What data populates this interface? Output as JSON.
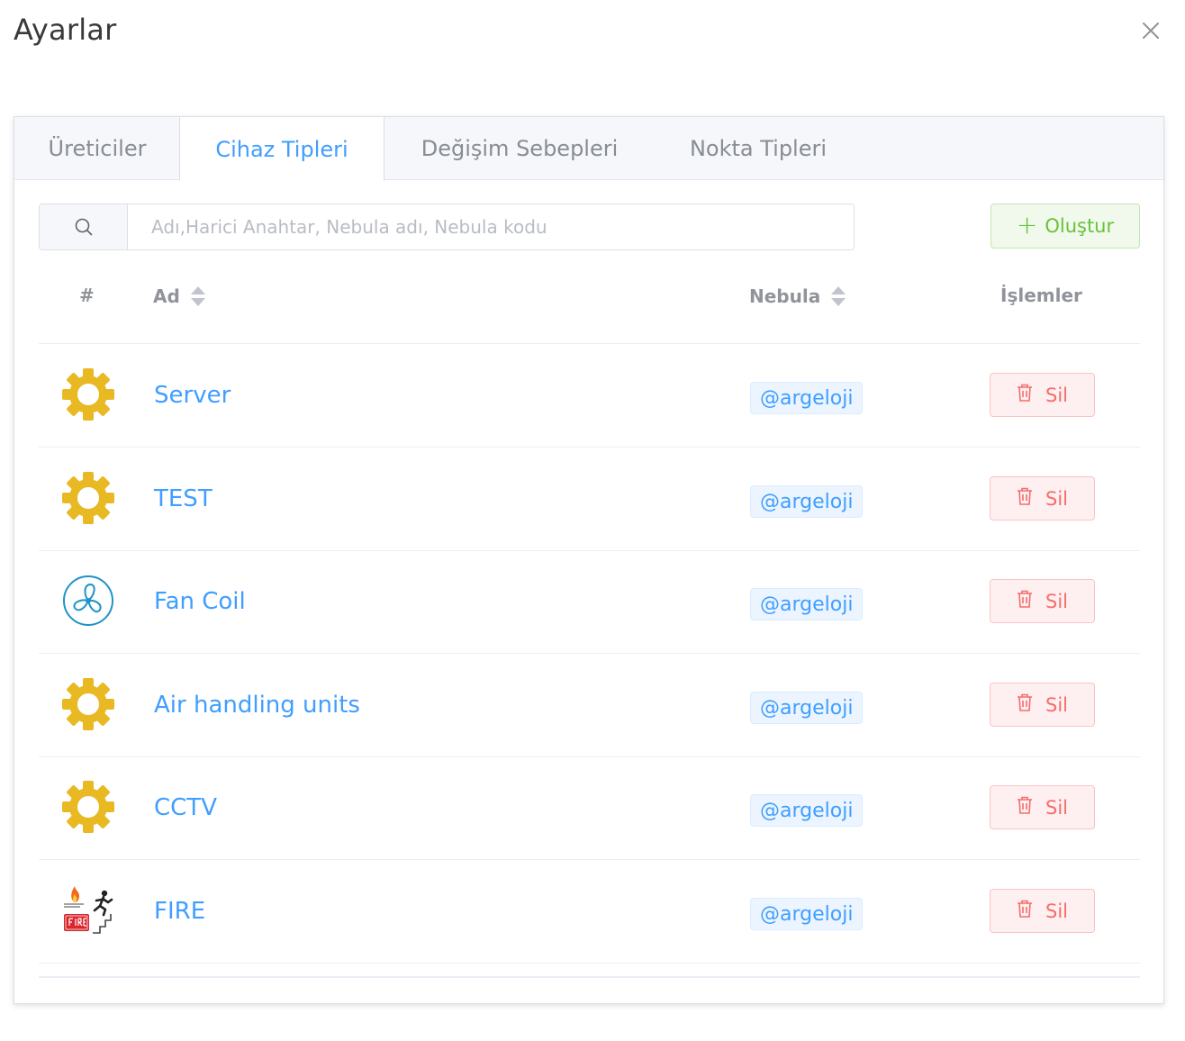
{
  "dialog": {
    "title": "Ayarlar"
  },
  "tabs": [
    {
      "label": "Üreticiler",
      "active": false
    },
    {
      "label": "Cihaz Tipleri",
      "active": true
    },
    {
      "label": "Değişim Sebepleri",
      "active": false
    },
    {
      "label": "Nokta Tipleri",
      "active": false
    }
  ],
  "search": {
    "placeholder": "Adı,Harici Anahtar, Nebula adı, Nebula kodu",
    "value": ""
  },
  "create_button": {
    "label": "Oluştur"
  },
  "table": {
    "headers": {
      "index": "#",
      "name": "Ad",
      "nebula": "Nebula",
      "actions": "İşlemler"
    },
    "rows": [
      {
        "icon": "gear-icon",
        "name": "Server",
        "nebula": "@argeloji",
        "delete_label": "Sil"
      },
      {
        "icon": "gear-icon",
        "name": "TEST",
        "nebula": "@argeloji",
        "delete_label": "Sil"
      },
      {
        "icon": "fan-icon",
        "name": "Fan Coil",
        "nebula": "@argeloji",
        "delete_label": "Sil"
      },
      {
        "icon": "gear-icon",
        "name": "Air handling units",
        "nebula": "@argeloji",
        "delete_label": "Sil"
      },
      {
        "icon": "gear-icon",
        "name": "CCTV",
        "nebula": "@argeloji",
        "delete_label": "Sil"
      },
      {
        "icon": "fire-exit-icon",
        "name": "FIRE",
        "nebula": "@argeloji",
        "delete_label": "Sil"
      }
    ]
  },
  "colors": {
    "accent": "#409eff",
    "success": "#67c23a",
    "danger": "#f56c6c",
    "gear": "#e8b923",
    "fan": "#1f93c7"
  }
}
